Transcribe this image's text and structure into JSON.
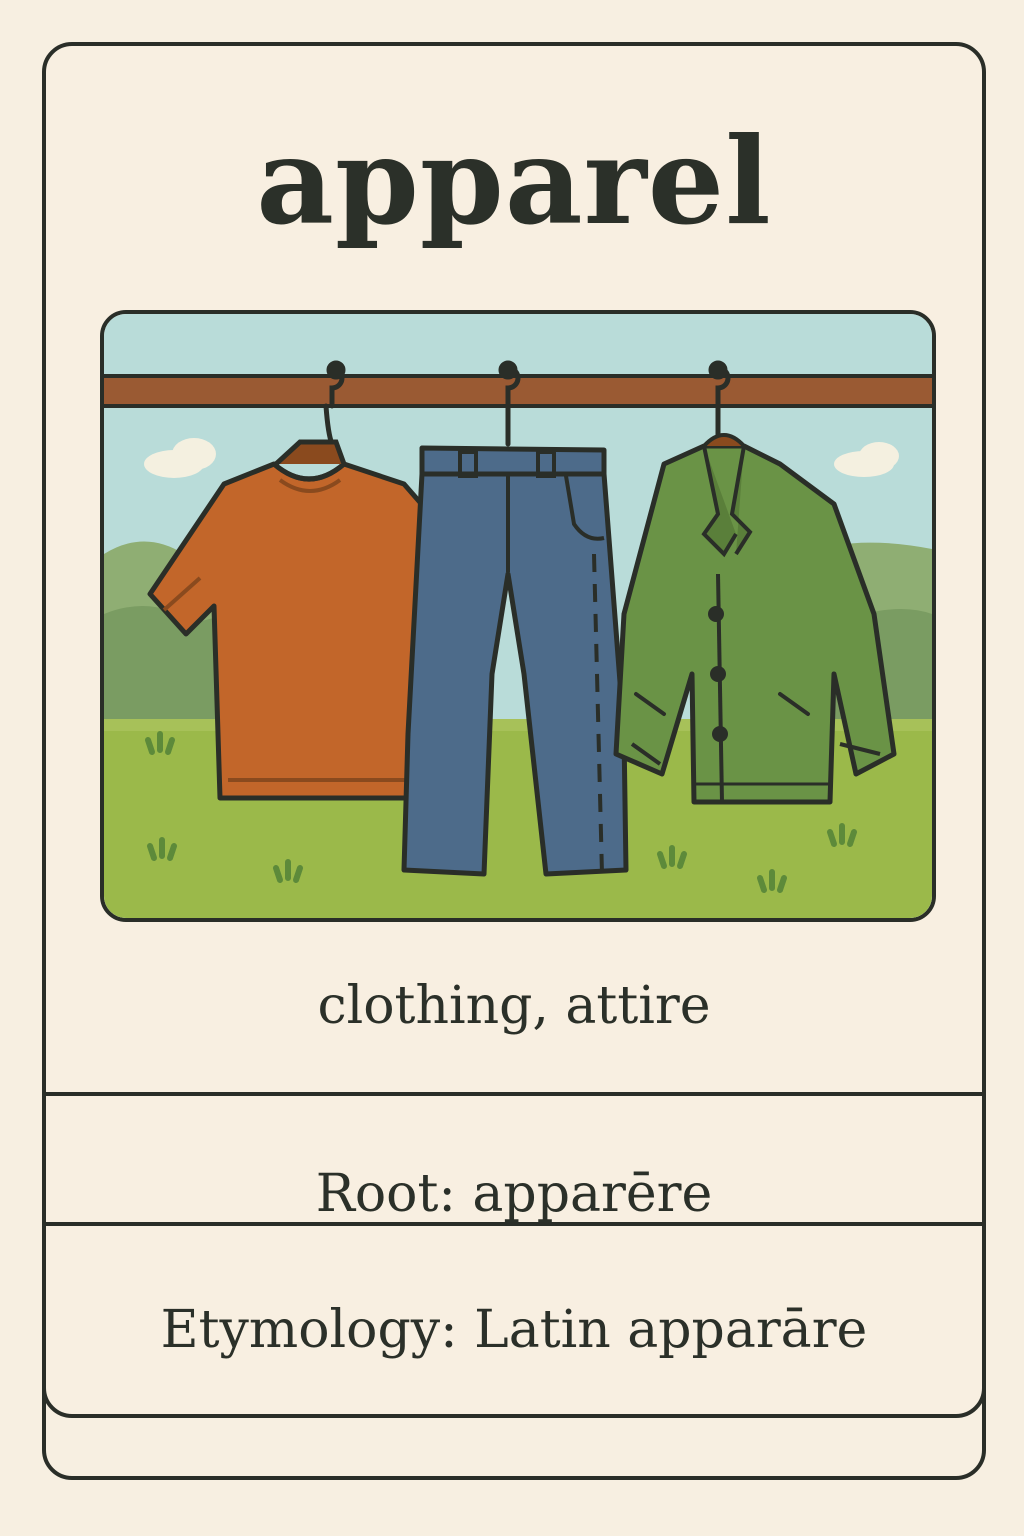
{
  "card": {
    "word": "apparel",
    "definition": "clothing, attire",
    "root": "Root: apparēre",
    "etymology": "Etymology: Latin apparāre"
  },
  "illustration": {
    "items": [
      "tshirt-icon",
      "jeans-icon",
      "jacket-icon"
    ],
    "colors": {
      "sky": "#b9dcd9",
      "grass": "#9bb94a",
      "rod": "#9a5a33",
      "tshirt": "#c2662a",
      "jeans": "#4d6b8a",
      "jacket": "#6a9346",
      "outline": "#2a2e28"
    }
  }
}
